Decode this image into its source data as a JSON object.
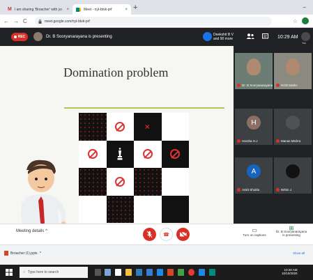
{
  "browser": {
    "tabs": [
      {
        "label": "I am sharing 'Broacher' with yo"
      },
      {
        "label": "Meet - nyt-btvk-prf"
      }
    ],
    "url": "meet.google.com/nyt-btvk-prf"
  },
  "meet": {
    "rec_label": "REC",
    "presenter_banner": "Dr. B Sooryanarayana is presenting",
    "participants_line1": "Deekshit B V",
    "participants_line2": "and 90 more",
    "time": "10:29 AM",
    "you_label": "You"
  },
  "slide": {
    "title": "Domination problem",
    "board": [
      [
        "b:dots",
        "w:ban",
        "b:cross",
        "w:empty"
      ],
      [
        "w:ban",
        "b:queen",
        "w:ban",
        "b:ban"
      ],
      [
        "b:dots",
        "w:ban",
        "b:dots",
        "w:empty"
      ],
      [
        "w:empty",
        "b:dots",
        "w:empty",
        "b:empty"
      ]
    ]
  },
  "participants": [
    {
      "name": "Dr. B Sooryanarayana",
      "kind": "video",
      "color": "#6b7d75"
    },
    {
      "name": "HOD Maths",
      "kind": "video",
      "color": "#8a8a80"
    },
    {
      "name": "Harsha H.J",
      "kind": "letter",
      "letter": "H",
      "color": "#8d6e63"
    },
    {
      "name": "Manas Mishra",
      "kind": "photo",
      "color": "#4e5254"
    },
    {
      "name": "Ankit Shukla",
      "kind": "letter",
      "letter": "A",
      "color": "#1565c0"
    },
    {
      "name": "Nithin J",
      "kind": "photo",
      "color": "#111111"
    }
  ],
  "controls": {
    "meeting_details": "Meeting details",
    "captions": "Turn on captions",
    "presenting_line1": "Dr. B Sooryanarayana",
    "presenting_line2": "is presenting"
  },
  "downloads": {
    "file": "Broacher (1).pptx",
    "show_all": "Show all"
  },
  "taskbar": {
    "search_placeholder": "Type here to search",
    "time": "10:29 AM",
    "date": "10/10/2020"
  }
}
